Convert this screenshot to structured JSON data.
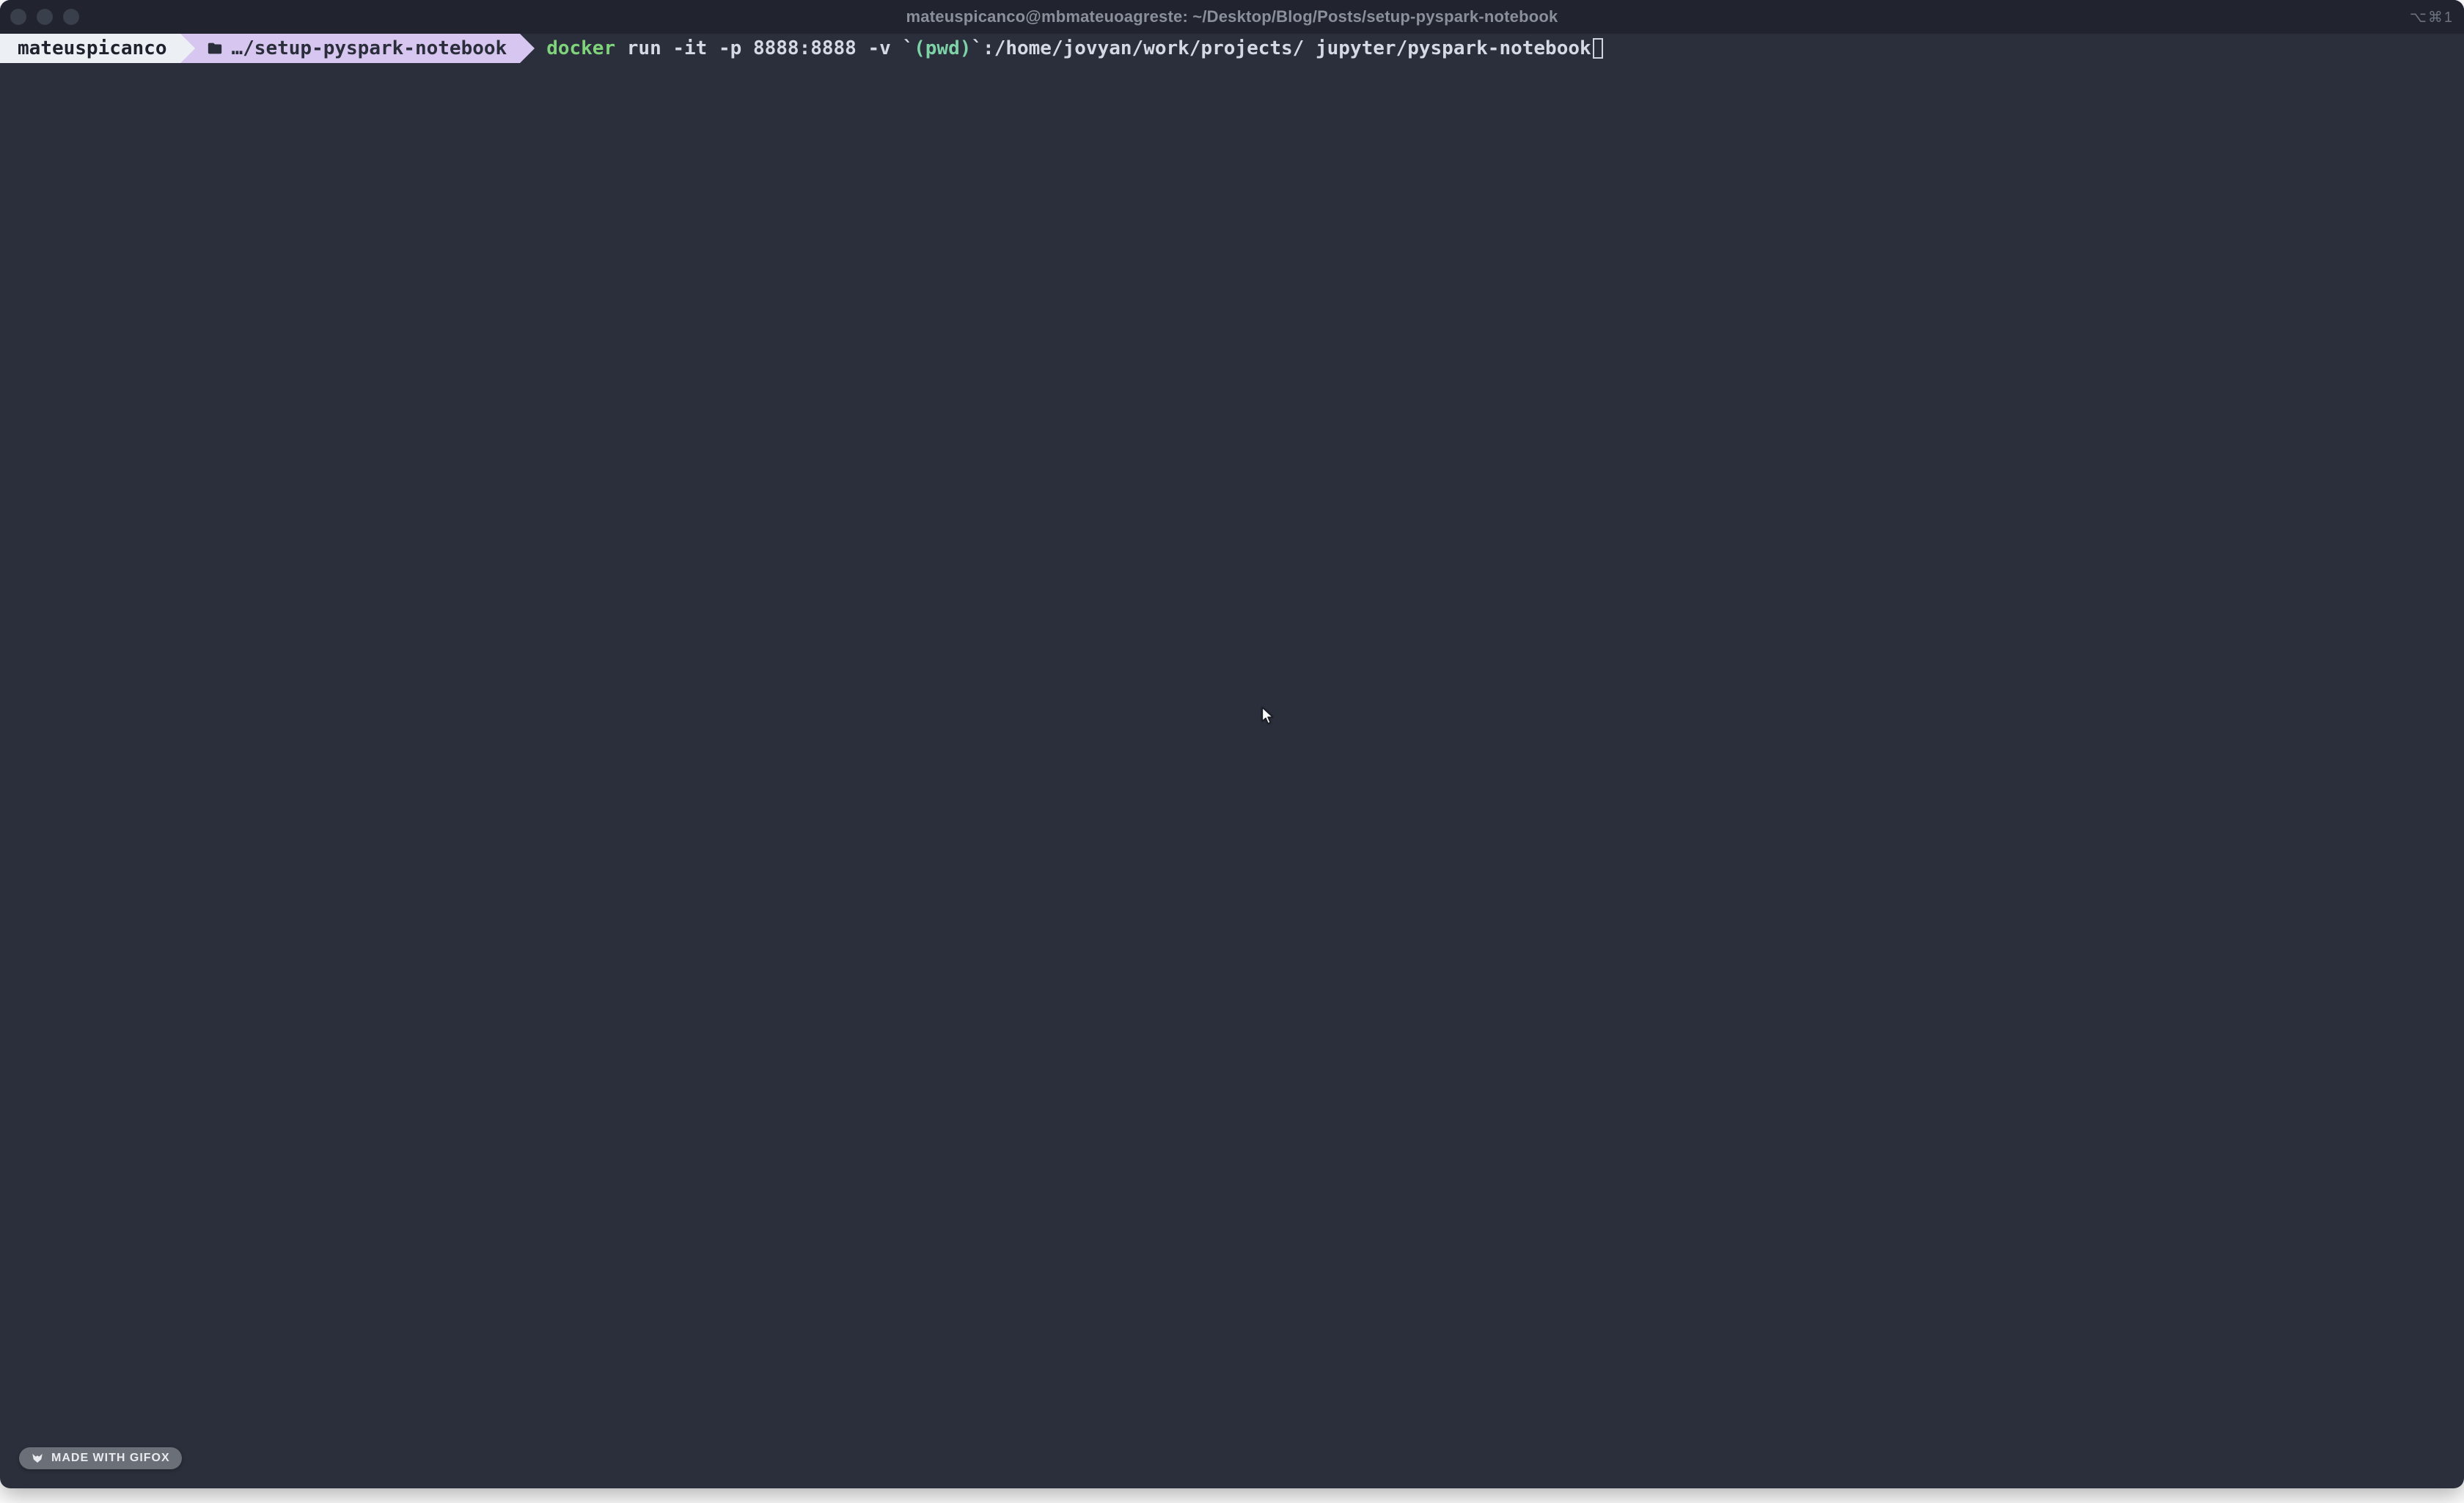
{
  "titlebar": {
    "title": "mateuspicanco@mbmateuoagreste: ~/Desktop/Blog/Posts/setup-pyspark-notebook",
    "right_hint": "⌥⌘1"
  },
  "prompt": {
    "user": "mateuspicanco",
    "path_display": "…/setup-pyspark-notebook"
  },
  "command": {
    "bin": "docker",
    "args_pre": " run -it -p 8888:8888 -v `",
    "subshell": "(pwd)",
    "args_post": "`:/home/jovyan/work/projects/ jupyter/pyspark-notebook"
  },
  "badge": {
    "text": "MADE WITH GIFOX"
  }
}
